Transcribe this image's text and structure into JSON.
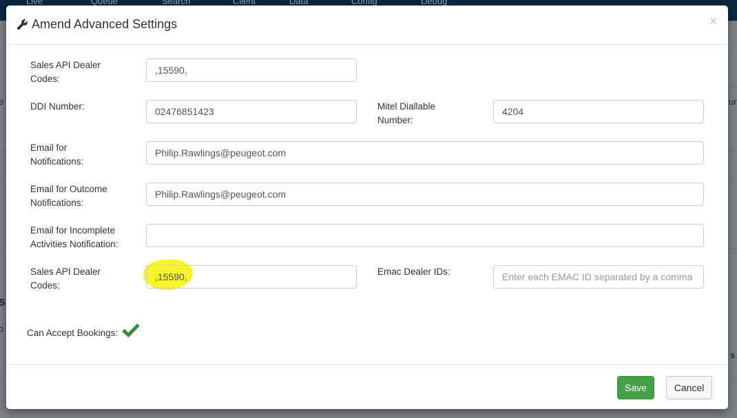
{
  "background_nav": {
    "items": [
      "Live",
      "Queue",
      "Search",
      "Client",
      "Data",
      "Config",
      "Debug"
    ]
  },
  "background_fragments": [
    "e",
    "ura",
    "s",
    "o",
    "s"
  ],
  "modal": {
    "title": "Amend Advanced Settings",
    "title_icon": "wrench-icon",
    "close_label": "×",
    "fields": {
      "sales_api_top": {
        "label": "Sales API Dealer Codes:",
        "value": ",15590,"
      },
      "ddi": {
        "label": "DDI Number:",
        "value": "02476851423"
      },
      "mitel": {
        "label": "Mitel Diallable Number:",
        "value": "4204"
      },
      "email_notifications": {
        "label": "Email for Notifications:",
        "value": "Philip.Rawlings@peugeot.com"
      },
      "email_outcome": {
        "label": "Email for Outcome Notifications:",
        "value": "Philip.Rawlings@peugeot.com"
      },
      "email_incomplete": {
        "label": "Email for Incomplete Activities Notification:",
        "value": ""
      },
      "sales_api_bottom": {
        "label": "Sales API Dealer Codes:",
        "value": ",15590,"
      },
      "emac": {
        "label": "Emac Dealer IDs:",
        "value": "",
        "placeholder": "Enter each EMAC ID separated by a comma w"
      }
    },
    "can_accept_bookings": {
      "label": "Can Accept Bookings:",
      "icon": "checkmark-icon",
      "color": "#3c8a3c"
    },
    "footer": {
      "save_label": "Save",
      "cancel_label": "Cancel"
    }
  },
  "colors": {
    "save_button": "#46a046",
    "highlight": "#f8f31d",
    "navbar": "#0a2742"
  }
}
